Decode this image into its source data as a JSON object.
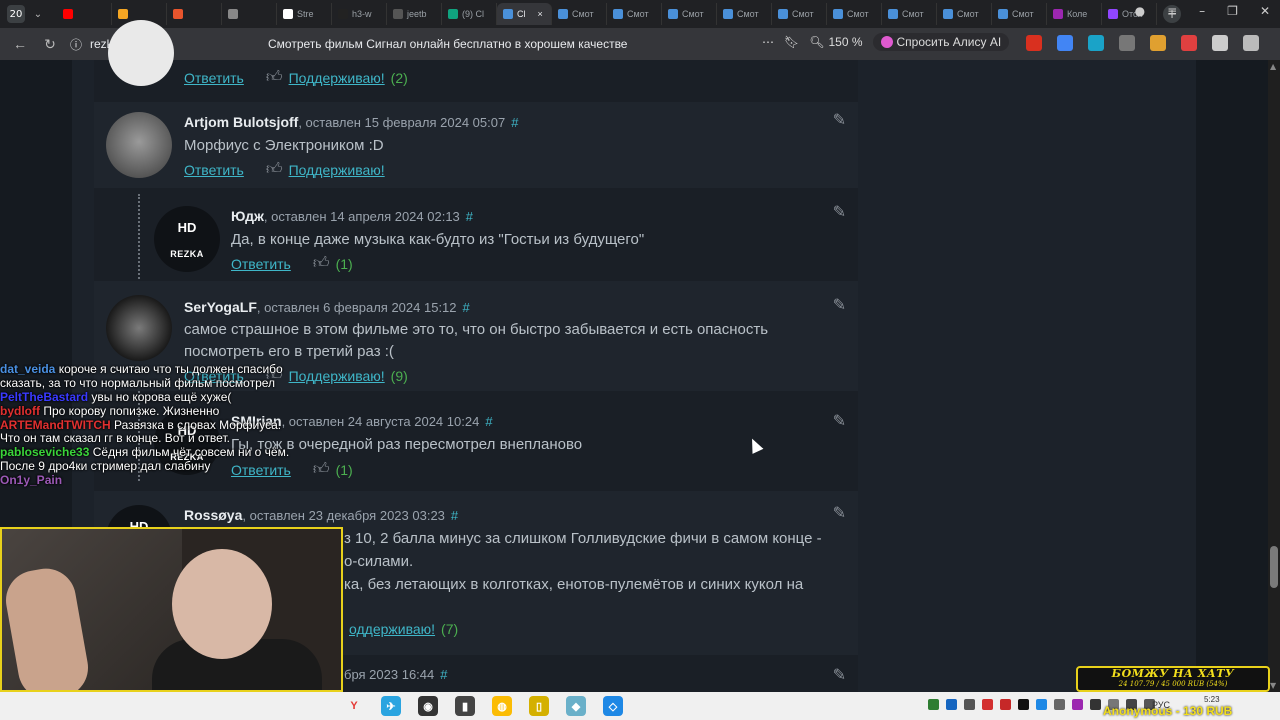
{
  "tabbar": {
    "tab_count": "20",
    "tabs": [
      {
        "label": "",
        "color": "#ff0000"
      },
      {
        "label": "",
        "color": "#f5a623"
      },
      {
        "label": "",
        "color": "#e8552d"
      },
      {
        "label": "",
        "color": "#888888"
      },
      {
        "label": "Stre",
        "color": "#ffffff"
      },
      {
        "label": "h3-w",
        "color": "#222222"
      },
      {
        "label": "jeetb",
        "color": "#555555"
      },
      {
        "label": "(9) Cl",
        "color": "#10a37f"
      },
      {
        "label": "Cl",
        "color": "#4a90d9"
      },
      {
        "label": "Смот",
        "color": "#4a90d9"
      },
      {
        "label": "Смот",
        "color": "#4a90d9"
      },
      {
        "label": "Смот",
        "color": "#4a90d9"
      },
      {
        "label": "Смот",
        "color": "#4a90d9"
      },
      {
        "label": "Смот",
        "color": "#4a90d9"
      },
      {
        "label": "Смот",
        "color": "#4a90d9"
      },
      {
        "label": "Смот",
        "color": "#4a90d9"
      },
      {
        "label": "Смот",
        "color": "#4a90d9"
      },
      {
        "label": "Смот",
        "color": "#4a90d9"
      },
      {
        "label": "Коле",
        "color": "#9c27b0"
      },
      {
        "label": "Отсл",
        "color": "#9146ff"
      }
    ],
    "active_tab_close": "×"
  },
  "addressbar": {
    "url": "rezka.fi",
    "title": "Смотреть фильм Сигнал онлайн бесплатно в хорошем качестве",
    "zoom": "150 %",
    "ask_alice": "Спросить Алису AI"
  },
  "comments": [
    {
      "author": "",
      "date": "",
      "text": "",
      "reply": "Ответить",
      "support": "Поддерживаю!",
      "count": "(2)"
    },
    {
      "author": "Artjom Bulotsjoff",
      "date": ", оставлен 15 февраля 2024 05:07",
      "text": "Морфиус с Электроником :D",
      "reply": "Ответить",
      "support": "Поддерживаю!",
      "count": ""
    },
    {
      "author": "Юдж",
      "date": ", оставлен 14 апреля 2024 02:13",
      "text": "Да, в конце даже музыка как-будто из \"Гостьи из будущего\"",
      "reply": "Ответить",
      "support": "",
      "count": "(1)"
    },
    {
      "author": "SerYogaLF",
      "date": ", оставлен 6 февраля 2024 15:12",
      "text": "самое страшное в этом фильме это то, что он быстро забывается и есть опасность посмотреть его в третий раз :(",
      "reply": "Ответить",
      "support": "Поддерживаю!",
      "count": "(9)"
    },
    {
      "author": "SMIrian",
      "date": ", оставлен 24 августа 2024 10:24",
      "text": "Гы, тож в очередной раз пересмотрел внепланово",
      "reply": "Ответить",
      "support": "",
      "count": "(1)"
    },
    {
      "author": "Rossøya",
      "date": ", оставлен 23 декабря 2023 03:23",
      "text1": "з 10, 2 балла минус за слишком Голливудские фичи в самом конце -",
      "text2": "о-силами.",
      "text3": "ка, без летающих в колготках, енотов-пулемётов и синих кукол на",
      "reply": "",
      "support": "оддерживаю!",
      "count": "(7)"
    },
    {
      "author": "",
      "date": "бря 2023 16:44",
      "text": "",
      "reply": "",
      "support": "",
      "count": ""
    }
  ],
  "hash": "#",
  "avatar_hd": {
    "top": "HD",
    "bottom": "REZKA"
  },
  "chat": [
    {
      "nick": "dat_veida",
      "color": "#4a90e2",
      "text": "короче я считаю что ты должен спасибо сказать, за то что нормальный фильм посмотрел"
    },
    {
      "nick": "PeltTheBastard",
      "color": "#3a3aff",
      "text": "увы но корова ещё хуже("
    },
    {
      "nick": "bydloff",
      "color": "#e03030",
      "text": "Про корову попизже. Жизненно"
    },
    {
      "nick": "ARTEMandTWITCH",
      "color": "#e03030",
      "text": "Развязка в словах Морфиуса. Что он там сказал гг в конце. Вот и ответ."
    },
    {
      "nick": "pablosevichе33",
      "color": "#3ad43a",
      "text": "Сёдня фильм чёт совсем ни о чём. После 9 дро4ки стример дал слабину"
    },
    {
      "nick": "On1y_Pain",
      "color": "#9b59b6",
      "text": ""
    }
  ],
  "donation": {
    "title": "БОМЖУ НА ХАТУ",
    "amount": "24 107.79 / 45 000 RUB (54%)",
    "progress": 0.54,
    "last": "Anonymous - 130 RUB"
  },
  "taskbar": {
    "lang": "РУС",
    "time": "5:23"
  }
}
